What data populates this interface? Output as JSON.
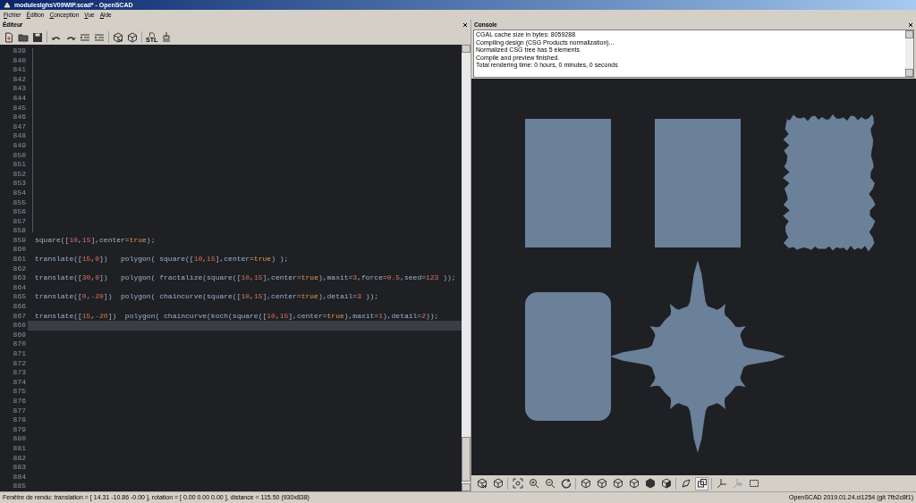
{
  "window": {
    "title": "moduleslghsV09WIP.scad* - OpenSCAD"
  },
  "menu": [
    "Fichier",
    "Édition",
    "Conception",
    "Vue",
    "Aide"
  ],
  "editor": {
    "title": "Éditeur",
    "export_label": "STL",
    "lines": [
      {
        "number": "839",
        "current": false
      },
      {
        "number": "840",
        "current": false
      },
      {
        "number": "841",
        "current": false
      },
      {
        "number": "842",
        "current": false
      },
      {
        "number": "843",
        "current": false
      },
      {
        "number": "844",
        "current": false
      },
      {
        "number": "845",
        "current": false
      },
      {
        "number": "846",
        "current": false
      },
      {
        "number": "847",
        "current": false
      },
      {
        "number": "848",
        "current": false
      },
      {
        "number": "849",
        "current": false
      },
      {
        "number": "850",
        "current": false
      },
      {
        "number": "851",
        "current": false
      },
      {
        "number": "852",
        "current": false
      },
      {
        "number": "853",
        "current": false
      },
      {
        "number": "854",
        "current": false
      },
      {
        "number": "855",
        "current": false
      },
      {
        "number": "856",
        "current": false
      },
      {
        "number": "857",
        "current": false
      },
      {
        "number": "858",
        "current": false
      },
      {
        "number": "859",
        "current": false,
        "tokens": [
          {
            "text": "square([",
            "kind": "plain"
          },
          {
            "text": "10",
            "kind": "number"
          },
          {
            "text": ",",
            "kind": "plain"
          },
          {
            "text": "15",
            "kind": "number"
          },
          {
            "text": "],center=",
            "kind": "plain"
          },
          {
            "text": "true",
            "kind": "keyword"
          },
          {
            "text": ");",
            "kind": "plain"
          }
        ]
      },
      {
        "number": "860",
        "current": false
      },
      {
        "number": "861",
        "current": false,
        "tokens": [
          {
            "text": "translate([",
            "kind": "plain"
          },
          {
            "text": "15",
            "kind": "number"
          },
          {
            "text": ",",
            "kind": "plain"
          },
          {
            "text": "0",
            "kind": "number"
          },
          {
            "text": "])   polygon( square([",
            "kind": "plain"
          },
          {
            "text": "10",
            "kind": "number"
          },
          {
            "text": ",",
            "kind": "plain"
          },
          {
            "text": "15",
            "kind": "number"
          },
          {
            "text": "],center=",
            "kind": "plain"
          },
          {
            "text": "true",
            "kind": "keyword"
          },
          {
            "text": ") );",
            "kind": "plain"
          }
        ]
      },
      {
        "number": "862",
        "current": false
      },
      {
        "number": "863",
        "current": false,
        "tokens": [
          {
            "text": "translate([",
            "kind": "plain"
          },
          {
            "text": "30",
            "kind": "number"
          },
          {
            "text": ",",
            "kind": "plain"
          },
          {
            "text": "0",
            "kind": "number"
          },
          {
            "text": "])   polygon( fractalize(square([",
            "kind": "plain"
          },
          {
            "text": "10",
            "kind": "number"
          },
          {
            "text": ",",
            "kind": "plain"
          },
          {
            "text": "15",
            "kind": "number"
          },
          {
            "text": "],center=",
            "kind": "plain"
          },
          {
            "text": "true",
            "kind": "keyword"
          },
          {
            "text": "),maxit=",
            "kind": "plain"
          },
          {
            "text": "3",
            "kind": "number"
          },
          {
            "text": ",force=",
            "kind": "plain"
          },
          {
            "text": "0.5",
            "kind": "number"
          },
          {
            "text": ",seed=",
            "kind": "plain"
          },
          {
            "text": "123",
            "kind": "number"
          },
          {
            "text": " ));",
            "kind": "plain"
          }
        ]
      },
      {
        "number": "864",
        "current": false
      },
      {
        "number": "865",
        "current": false,
        "tokens": [
          {
            "text": "translate([",
            "kind": "plain"
          },
          {
            "text": "0",
            "kind": "number"
          },
          {
            "text": ",",
            "kind": "plain"
          },
          {
            "text": "-20",
            "kind": "number"
          },
          {
            "text": "])  polygon( chaincurve(square([",
            "kind": "plain"
          },
          {
            "text": "10",
            "kind": "number"
          },
          {
            "text": ",",
            "kind": "plain"
          },
          {
            "text": "15",
            "kind": "number"
          },
          {
            "text": "],center=",
            "kind": "plain"
          },
          {
            "text": "true",
            "kind": "keyword"
          },
          {
            "text": "),detail=",
            "kind": "plain"
          },
          {
            "text": "3",
            "kind": "number"
          },
          {
            "text": " ));",
            "kind": "plain"
          }
        ]
      },
      {
        "number": "866",
        "current": false
      },
      {
        "number": "867",
        "current": false,
        "tokens": [
          {
            "text": "translate([",
            "kind": "plain"
          },
          {
            "text": "15",
            "kind": "number"
          },
          {
            "text": ",",
            "kind": "plain"
          },
          {
            "text": "-20",
            "kind": "number"
          },
          {
            "text": "])  polygon( chaincurve(koch(square([",
            "kind": "plain"
          },
          {
            "text": "10",
            "kind": "number"
          },
          {
            "text": ",",
            "kind": "plain"
          },
          {
            "text": "15",
            "kind": "number"
          },
          {
            "text": "],center=",
            "kind": "plain"
          },
          {
            "text": "true",
            "kind": "keyword"
          },
          {
            "text": "),maxit=",
            "kind": "plain"
          },
          {
            "text": "1",
            "kind": "number"
          },
          {
            "text": "),detail=",
            "kind": "plain"
          },
          {
            "text": "2",
            "kind": "number"
          },
          {
            "text": "));",
            "kind": "plain"
          }
        ]
      },
      {
        "number": "868",
        "current": true
      },
      {
        "number": "869",
        "current": false
      },
      {
        "number": "870",
        "current": false
      },
      {
        "number": "871",
        "current": false
      },
      {
        "number": "872",
        "current": false
      },
      {
        "number": "873",
        "current": false
      },
      {
        "number": "874",
        "current": false
      },
      {
        "number": "875",
        "current": false
      },
      {
        "number": "876",
        "current": false
      },
      {
        "number": "877",
        "current": false
      },
      {
        "number": "878",
        "current": false
      },
      {
        "number": "879",
        "current": false
      },
      {
        "number": "880",
        "current": false
      },
      {
        "number": "881",
        "current": false
      },
      {
        "number": "882",
        "current": false
      },
      {
        "number": "883",
        "current": false
      },
      {
        "number": "884",
        "current": false
      },
      {
        "number": "885",
        "current": false
      }
    ]
  },
  "console": {
    "title": "Console",
    "lines": [
      "CGAL cache size in bytes: 8059288",
      "Compiling design (CSG Products normalization)...",
      "Normalized CSG tree has 5 elements",
      "Compile and preview finished.",
      "Total rendering time: 0 hours, 0 minutes, 0 seconds"
    ]
  },
  "view_toolbar": [
    {
      "selected": false
    },
    {
      "selected": false
    },
    {
      "selected": false
    },
    {
      "selected": false
    },
    {
      "selected": false
    },
    {
      "selected": false
    },
    {
      "selected": false
    },
    {
      "selected": false
    },
    {
      "selected": false
    },
    {
      "selected": false
    },
    {
      "selected": false
    },
    {
      "selected": false
    },
    {
      "selected": false
    },
    {
      "selected": true
    },
    {
      "selected": false
    },
    {
      "selected": false
    },
    {
      "selected": false
    }
  ],
  "status_bar": {
    "left": "Fenêtre de rendu: translation = [ 14.31 -10.86 -0.00 ], rotation = [ 0.00 0.00 0.00 ], distance = 115.50 (930x838)",
    "right": "OpenSCAD 2019.01.24.ci1254 (git 7fb2c8f1)"
  }
}
